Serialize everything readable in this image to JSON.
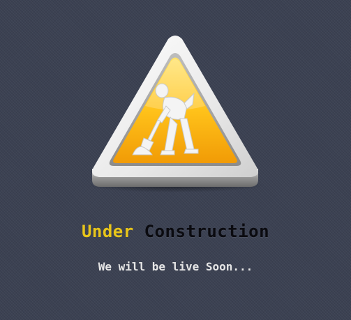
{
  "colors": {
    "background": "#3b4152",
    "accent_yellow": "#e8c51a",
    "heading_dark": "#0b0b10",
    "tagline_text": "#e6e6e6"
  },
  "sign": {
    "icon": "under-construction-worker-sign"
  },
  "headline": {
    "word1": "Under",
    "word2": "Construction"
  },
  "tagline": {
    "text": "We will be live Soon..."
  }
}
